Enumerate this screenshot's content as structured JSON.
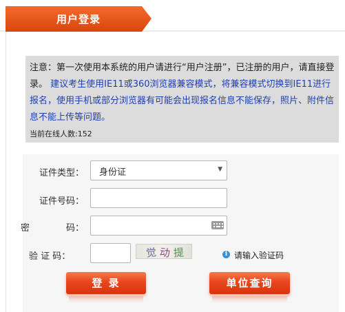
{
  "header": {
    "title": "用户登录"
  },
  "notice": {
    "line1": "注意：第一次使用本系统的用户请进行“用户注册”，已注册的用户，请直接登录。",
    "line2_blue": "建议考生使用IE11或360浏览器兼容模式，将兼容模式切换到IE11进行报名，使用手机或部分浏览器有可能会出现报名信息不能保存，照片、附件信息不能上传等问题。",
    "online_label": "当前在线人数:",
    "online_count": "152"
  },
  "form": {
    "id_type_label": "证件类型：",
    "id_type_value": "身份证",
    "id_number_label": "证件号码：",
    "id_number_value": "",
    "password_label_1": "密",
    "password_label_2": "码：",
    "password_value": "",
    "captcha_label": "验 证 码：",
    "captcha_value": "",
    "captcha_image_text": [
      "觉",
      "动",
      "提"
    ],
    "captcha_hint": "请输入验证码"
  },
  "buttons": {
    "login": "登 录",
    "unit_query": "单位查询"
  },
  "icons": {
    "select": "chevron-down-icon",
    "keyboard": "keyboard-icon",
    "info": "info-icon"
  },
  "colors": {
    "accent": "#e8461d",
    "notice_bg": "#dcdcdc",
    "notice_blue": "#1f3fb0",
    "form_bg": "#f6f6f6"
  }
}
